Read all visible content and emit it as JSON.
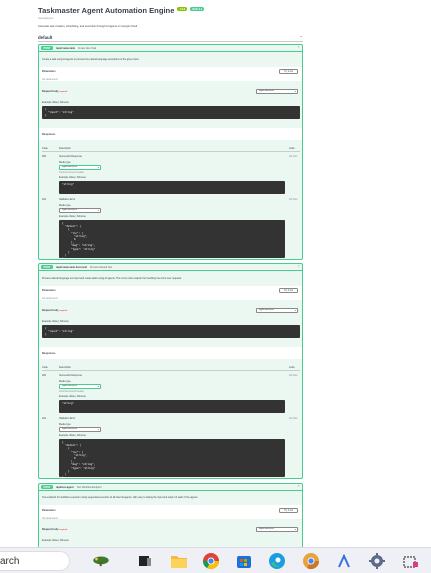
{
  "api": {
    "title": "Taskmaster Agent Automation Engine",
    "version_badge": "1.0.0",
    "oas_badge": "OAS 3.1",
    "subtitle": "/openapi.json",
    "description": "Automate task creation, scheduling, and execution through AI agents on Google Cloud"
  },
  "tag": {
    "name": "default",
    "chevron": "⌃"
  },
  "operations": [
    {
      "method": "POST",
      "path": "/api/create-task",
      "summary": "Create New Task",
      "description": "Create a task using AI agents to process the natural language description of the given input.",
      "parameters_label": "Parameters",
      "try_label": "Try it out",
      "no_params": "No parameters",
      "request_body_label": "Request body",
      "required": "required",
      "content_type": "application/json",
      "example_label": "Example Value | Schema",
      "example_code": "{\n  \"input\": \"string\"\n}",
      "responses_label": "Responses",
      "code_header": "Code",
      "desc_header": "Description",
      "links_header": "Links",
      "responses": [
        {
          "code": "200",
          "description": "Successful Response",
          "media_label": "Media type",
          "media_type": "application/json",
          "controls_label": "Controls Accept header.",
          "example_label": "Example Value | Schema",
          "links": "No links",
          "example_code": "\"string\""
        },
        {
          "code": "422",
          "description": "Validation Error",
          "media_label": "Media type",
          "media_type": "application/json",
          "example_label": "Example Value | Schema",
          "links": "No links",
          "example_code": "{\n  \"detail\": [\n    {\n      \"loc\": [\n        \"string\",\n        0\n      ],\n      \"msg\": \"string\",\n      \"type\": \"string\"\n    }\n  ]\n}"
        }
      ]
    },
    {
      "method": "POST",
      "path": "/api/create-task-from-text",
      "summary": "Process Natural Text",
      "description": "Process natural language text input and create tasks using AI agents. This is the main endpoint for handling free-form user requests.",
      "parameters_label": "Parameters",
      "try_label": "Try it out",
      "no_params": "No parameters",
      "request_body_label": "Request body",
      "required": "required",
      "content_type": "application/json",
      "example_label": "Example Value | Schema",
      "example_code": "{\n  \"input\": \"string\"\n}",
      "responses_label": "Responses",
      "code_header": "Code",
      "desc_header": "Description",
      "links_header": "Links",
      "responses": [
        {
          "code": "200",
          "description": "Successful Response",
          "media_label": "Media type",
          "media_type": "application/json",
          "controls_label": "Controls Accept header.",
          "example_label": "Example Value | Schema",
          "links": "No links",
          "example_code": "\"string\""
        },
        {
          "code": "422",
          "description": "Validation Error",
          "media_label": "Media type",
          "media_type": "application/json",
          "example_label": "Example Value | Schema",
          "links": "No links",
          "example_code": "{\n  \"detail\": [\n    {\n      \"loc\": [\n        \"string\",\n        0\n      ],\n      \"msg\": \"string\",\n      \"type\": \"string\"\n    }\n  ]\n}"
        }
      ]
    },
    {
      "method": "POST",
      "path": "/api/test-agent",
      "summary": "Test Workflow Endpoint",
      "description": "Test endpoint for workflow execution using sequential execution of all internal agents, with easy to debug the input and output of each of the agents.",
      "parameters_label": "Parameters",
      "try_label": "Try it out",
      "no_params": "No parameters",
      "request_body_label": "Request body",
      "required": "required",
      "content_type": "application/json",
      "example_label": "Example Value | Schema"
    }
  ],
  "taskbar": {
    "search_text": "arch",
    "icons": [
      "tree-widget-icon",
      "task-view-icon",
      "file-explorer-icon",
      "chrome-icon",
      "store-icon",
      "edge-icon",
      "chrome-canary-icon",
      "arc-icon",
      "settings-icon",
      "snipping-tool-icon"
    ]
  }
}
